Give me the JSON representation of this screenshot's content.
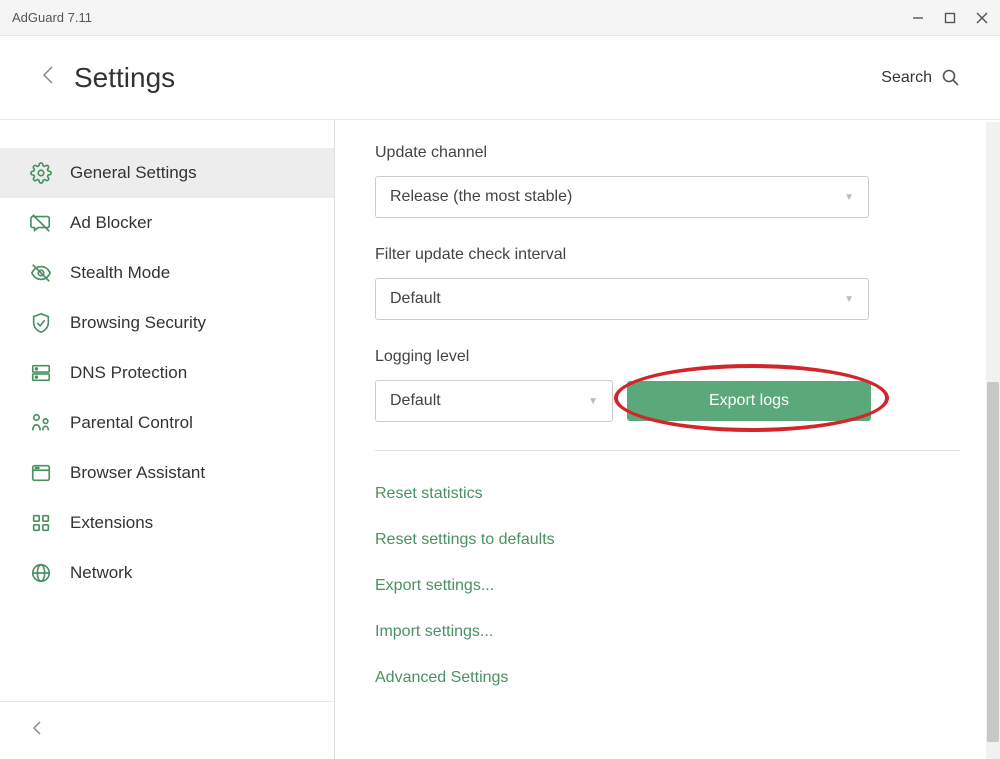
{
  "window": {
    "title": "AdGuard 7.11"
  },
  "header": {
    "title": "Settings",
    "search_label": "Search"
  },
  "sidebar": {
    "items": [
      {
        "label": "General Settings"
      },
      {
        "label": "Ad Blocker"
      },
      {
        "label": "Stealth Mode"
      },
      {
        "label": "Browsing Security"
      },
      {
        "label": "DNS Protection"
      },
      {
        "label": "Parental Control"
      },
      {
        "label": "Browser Assistant"
      },
      {
        "label": "Extensions"
      },
      {
        "label": "Network"
      }
    ]
  },
  "main": {
    "update_channel": {
      "label": "Update channel",
      "value": "Release (the most stable)"
    },
    "filter_interval": {
      "label": "Filter update check interval",
      "value": "Default"
    },
    "logging": {
      "label": "Logging level",
      "value": "Default",
      "export_label": "Export logs"
    },
    "links": {
      "reset_stats": "Reset statistics",
      "reset_settings": "Reset settings to defaults",
      "export_settings": "Export settings...",
      "import_settings": "Import settings...",
      "advanced": "Advanced Settings"
    }
  },
  "colors": {
    "accent_green": "#4a9161",
    "button_green": "#5ba97a",
    "highlight_red": "#d1272b"
  }
}
